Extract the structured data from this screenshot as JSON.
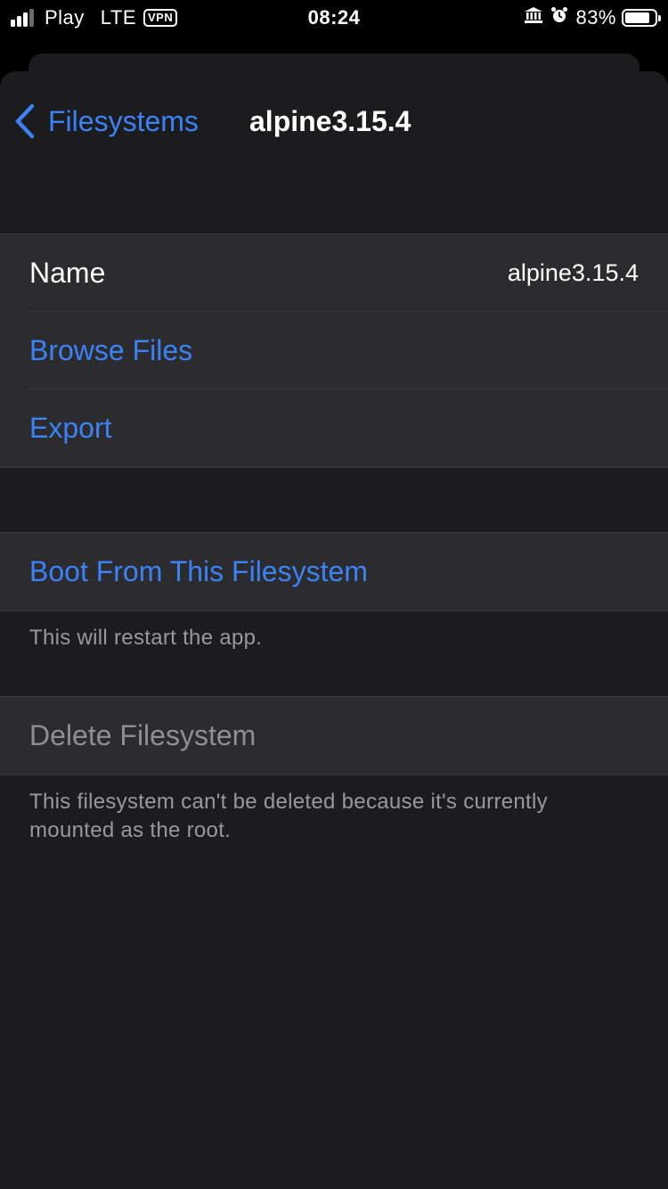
{
  "status_bar": {
    "carrier": "Play",
    "network": "LTE",
    "vpn": "VPN",
    "time": "08:24",
    "battery_percent": "83%",
    "battery_level": 0.83,
    "signal_bars_active": 3,
    "signal_bars_total": 4,
    "icons": [
      "bank-icon",
      "alarm-icon"
    ]
  },
  "nav": {
    "back_label": "Filesystems",
    "title": "alpine3.15.4"
  },
  "info_group": {
    "name_label": "Name",
    "name_value": "alpine3.15.4",
    "browse_label": "Browse Files",
    "export_label": "Export"
  },
  "boot_group": {
    "boot_label": "Boot From This Filesystem",
    "boot_note": "This will restart the app."
  },
  "delete_group": {
    "delete_label": "Delete Filesystem",
    "delete_note": "This filesystem can't be deleted because it's currently mounted as the root."
  },
  "colors": {
    "accent": "#3b82f6",
    "background": "#1c1c1e",
    "cell": "#2c2c2e",
    "secondary_text": "#98989d"
  }
}
